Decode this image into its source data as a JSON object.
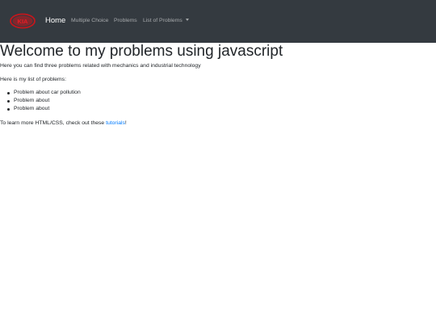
{
  "navbar": {
    "logo_text": "KIA",
    "home_label": "Home",
    "multiple_choice_label": "Multiple Choice",
    "problems_label": "Problems",
    "list_of_problems_label": "List of Problems",
    "background_color": "#343a40"
  },
  "main": {
    "title": "Welcome to my problems using javascript",
    "intro": "Here you can find three problems related with mechanics and industrial technology",
    "list_intro": "Here is my list of problems:",
    "problems": [
      "Problem about car pollution",
      "Problem about",
      "Problem about"
    ],
    "learn_more_before": "To learn more HTML/CSS, check out these ",
    "learn_more_link": "tutorials",
    "learn_more_after": "!",
    "link_color": "#007bff"
  }
}
